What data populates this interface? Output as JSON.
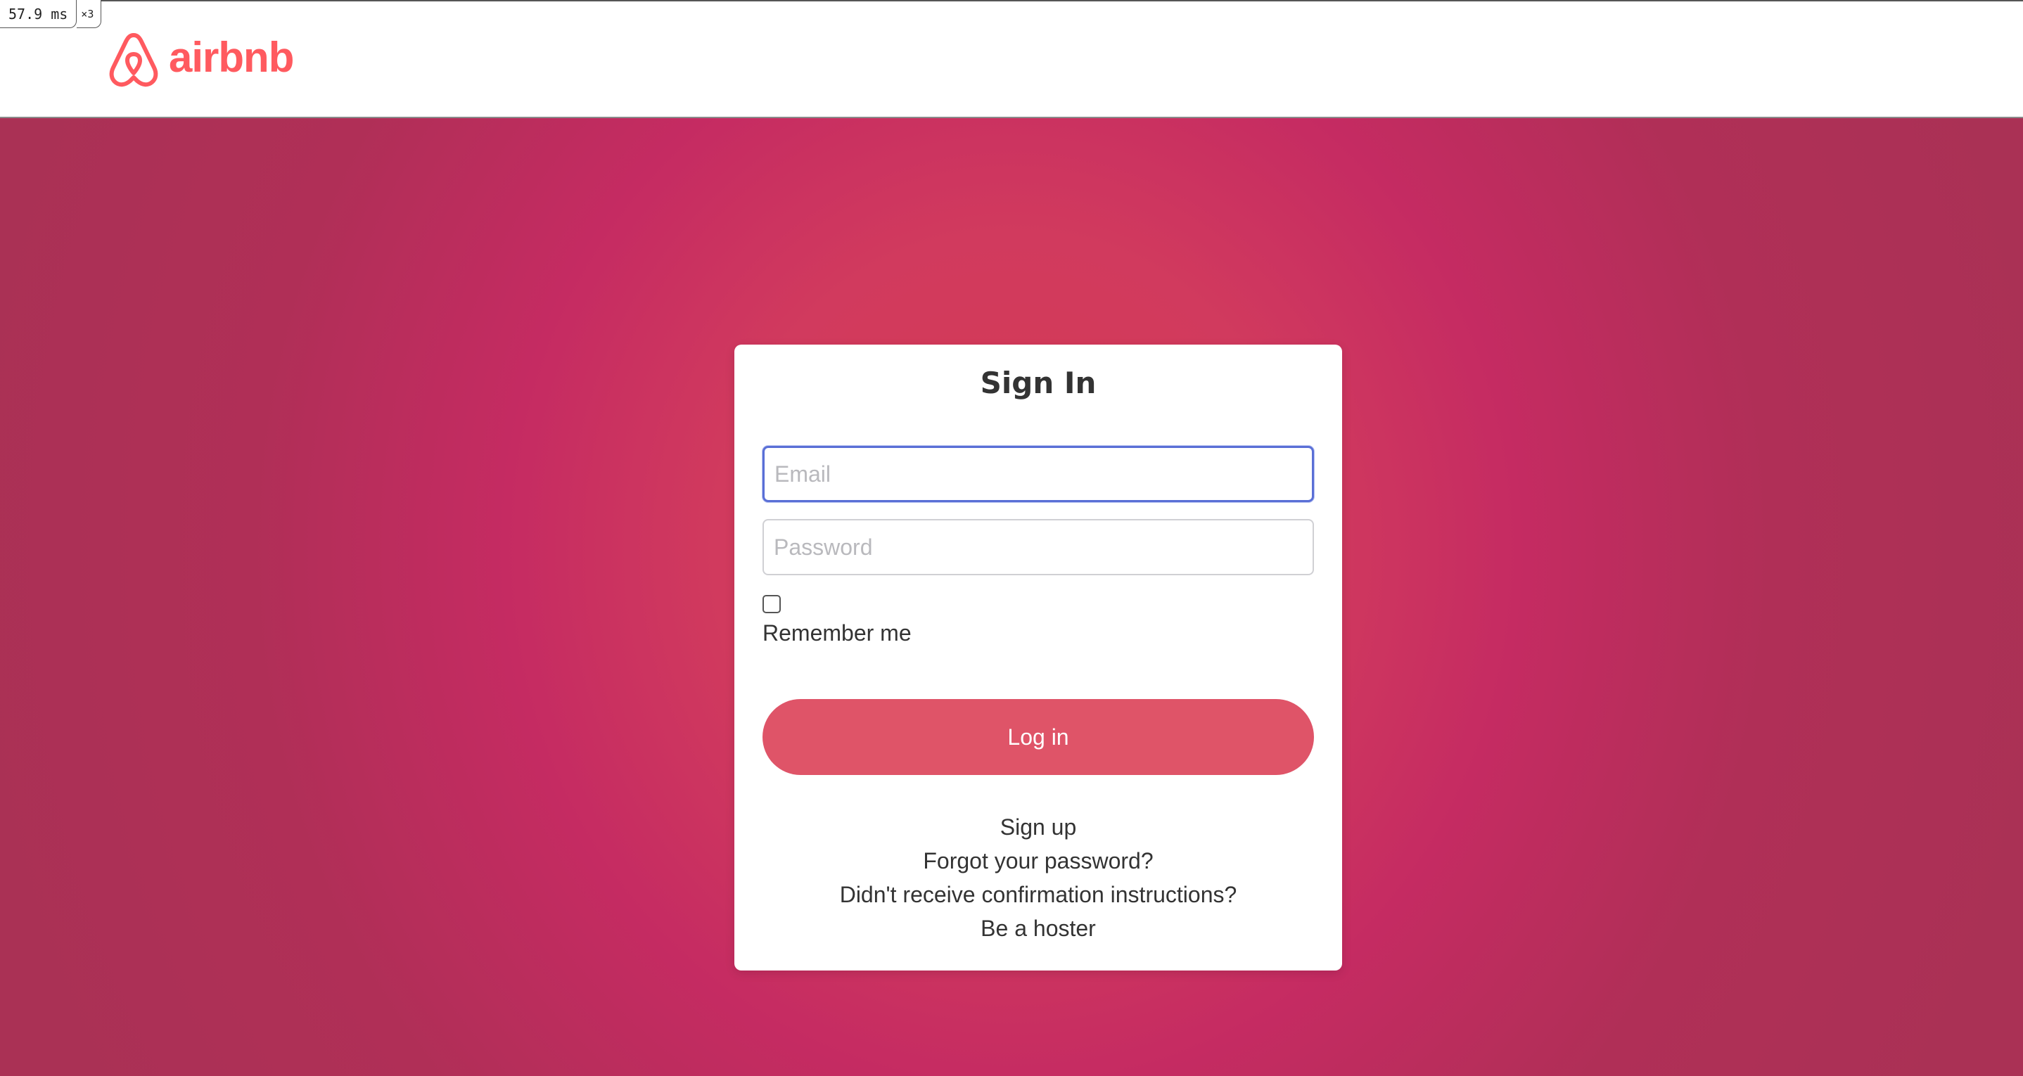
{
  "profiler": {
    "time": "57.9 ms",
    "multiplier": "×3"
  },
  "header": {
    "logo_text": "airbnb",
    "brand_color": "#ff5a5f"
  },
  "signin": {
    "title": "Sign In",
    "email": {
      "placeholder": "Email",
      "value": ""
    },
    "password": {
      "placeholder": "Password",
      "value": ""
    },
    "remember_me": {
      "label": "Remember me",
      "checked": false
    },
    "login_button": "Log in",
    "login_button_color": "#df5468",
    "links": {
      "sign_up": "Sign up",
      "forgot_password": "Forgot your password?",
      "confirmation": "Didn't receive confirmation instructions?",
      "be_hoster": "Be a hoster"
    }
  },
  "icons": {
    "logo": "airbnb-belo-icon",
    "checkbox": "checkbox-unchecked"
  }
}
